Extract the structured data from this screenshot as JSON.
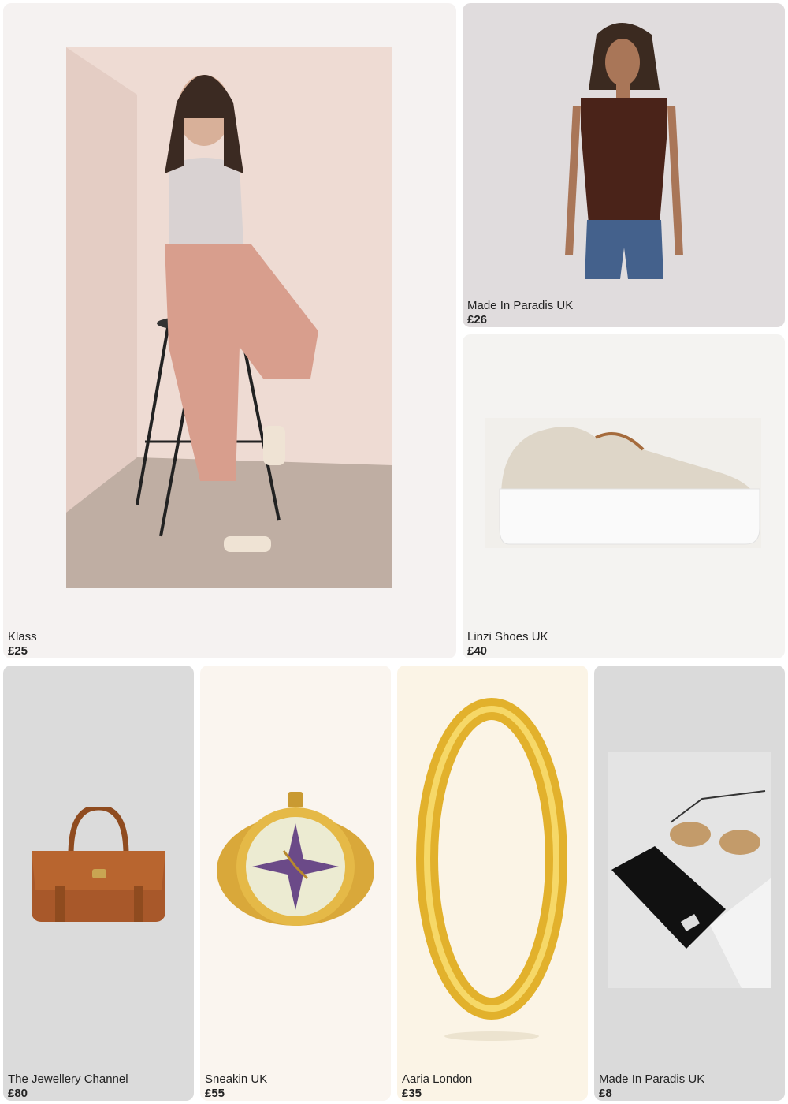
{
  "products": [
    {
      "brand": "Klass",
      "price": "£25",
      "image": "woman-seated-on-stool-in-pink-trousers"
    },
    {
      "brand": "Made In Paradis UK",
      "price": "£26",
      "image": "brown-ribbed-vest-top"
    },
    {
      "brand": "Linzi Shoes UK",
      "price": "£40",
      "image": "beige-flatform-sneaker"
    },
    {
      "brand": "The Jewellery Channel",
      "price": "£80",
      "image": "tan-leather-satchel"
    },
    {
      "brand": "Sneakin UK",
      "price": "£55",
      "image": "gold-ring-watch"
    },
    {
      "brand": "Aaria London",
      "price": "£35",
      "image": "gold-hoop-earring"
    },
    {
      "brand": "Made In Paradis UK",
      "price": "£8",
      "image": "sunglasses-with-pouch"
    }
  ],
  "colors": {
    "caption_text": "#222222",
    "card_bg_1": "#f5f2f1",
    "card_bg_2": "#e0dcdd",
    "card_bg_3": "#f4f3f1",
    "card_bg_4": "#dbdbdb",
    "card_bg_5": "#faf5ef",
    "card_bg_6": "#fbf4e6",
    "card_bg_7": "#dadada"
  }
}
